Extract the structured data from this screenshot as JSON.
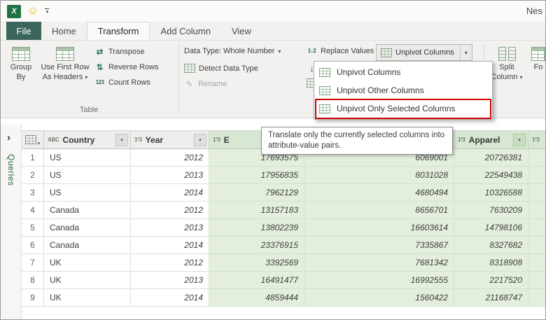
{
  "titlebar": {
    "title": "Nes"
  },
  "tabs": {
    "file": "File",
    "items": [
      "Home",
      "Transform",
      "Add Column",
      "View"
    ],
    "active": "Transform"
  },
  "ribbon": {
    "group_by": "Group By",
    "use_first_row": "Use First Row As Headers",
    "transpose": "Transpose",
    "reverse_rows": "Reverse Rows",
    "count_rows": "Count Rows",
    "table_group_label": "Table",
    "data_type": "Data Type: Whole Number",
    "detect_data_type": "Detect Data Type",
    "rename": "Rename",
    "replace_values": "Replace Values",
    "unpivot_columns": "Unpivot Columns",
    "split_column": "Split Column",
    "format_truncated": "Fo"
  },
  "icons": {
    "excel": "X",
    "smiley": "☺",
    "dropdown_arrow": "▾",
    "filter_arrow": "▾",
    "chevron_right": "›",
    "transpose": "⇄",
    "reverse_rows": "⇅",
    "count_rows": "123",
    "replace_values": "1↓2",
    "fill_down": "↓",
    "rename": "✎"
  },
  "menu": {
    "items": [
      "Unpivot Columns",
      "Unpivot Other Columns",
      "Unpivot Only Selected Columns"
    ],
    "annotated": "Unpivot Only Selected Columns",
    "annotation_color": "#cf0000"
  },
  "tooltip": {
    "text": "Translate only the currently selected columns into attribute-value pairs."
  },
  "sidebar": {
    "label": "Queries"
  },
  "table": {
    "columns": [
      {
        "icon": "ABC",
        "label": "Country",
        "selected": false
      },
      {
        "icon": "1²3",
        "label": "Year",
        "selected": false
      },
      {
        "icon": "1²3",
        "label": "E",
        "selected": true
      },
      {
        "icon": "1²3",
        "label": "",
        "selected": true
      },
      {
        "icon": "1²3",
        "label": "Apparel",
        "selected": true
      },
      {
        "icon": "1²3",
        "label": "",
        "selected": true
      }
    ],
    "rows": [
      [
        "1",
        "US",
        "2012",
        "17693575",
        "6069001",
        "20726381"
      ],
      [
        "2",
        "US",
        "2013",
        "17956835",
        "8031028",
        "22549438"
      ],
      [
        "3",
        "US",
        "2014",
        "7962129",
        "4680494",
        "10326588"
      ],
      [
        "4",
        "Canada",
        "2012",
        "13157183",
        "8656701",
        "7630209"
      ],
      [
        "5",
        "Canada",
        "2013",
        "13802239",
        "16603614",
        "14798106"
      ],
      [
        "6",
        "Canada",
        "2014",
        "23376915",
        "7335867",
        "8327682"
      ],
      [
        "7",
        "UK",
        "2012",
        "3392569",
        "7681342",
        "8318908"
      ],
      [
        "8",
        "UK",
        "2013",
        "16491477",
        "16992555",
        "2217520"
      ],
      [
        "9",
        "UK",
        "2014",
        "4859444",
        "1560422",
        "21168747"
      ]
    ]
  }
}
